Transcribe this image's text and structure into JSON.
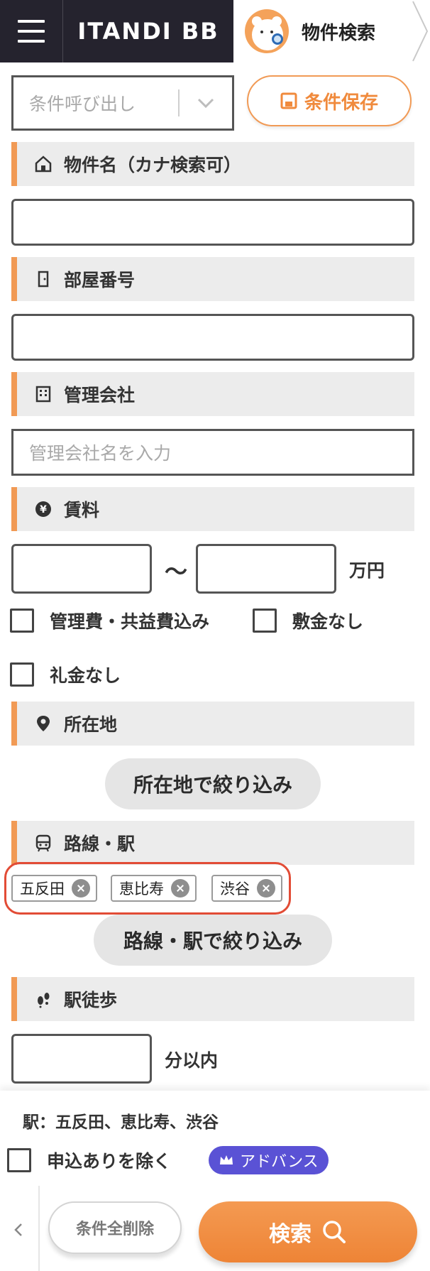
{
  "header": {
    "menu_icon": "hamburger-icon",
    "logo": "ITANDI BB",
    "breadcrumb": "物件検索",
    "mascot_icon": "bear-search-icon"
  },
  "conditions": {
    "select_placeholder": "条件呼び出し",
    "save_label": "条件保存"
  },
  "sections": {
    "property_name": {
      "label": "物件名（カナ検索可）",
      "icon": "home-icon"
    },
    "room_number": {
      "label": "部屋番号",
      "icon": "door-icon"
    },
    "management": {
      "label": "管理会社",
      "icon": "building-icon",
      "placeholder": "管理会社名を入力"
    },
    "rent": {
      "label": "賃料",
      "icon": "yen-icon",
      "tilde": "〜",
      "unit": "万円"
    },
    "location": {
      "label": "所在地",
      "icon": "pin-icon",
      "button": "所在地で絞り込み"
    },
    "line_station": {
      "label": "路線・駅",
      "icon": "train-icon",
      "button": "路線・駅で絞り込み"
    },
    "walk": {
      "label": "駅徒歩",
      "icon": "footprint-icon",
      "unit": "分以内"
    }
  },
  "checkboxes": {
    "management_fee": "管理費・共益費込み",
    "no_deposit": "敷金なし",
    "no_key_money": "礼金なし",
    "exclude_applied": "申込ありを除く"
  },
  "stations": [
    "五反田",
    "恵比寿",
    "渋谷"
  ],
  "summary": "駅：五反田、恵比寿、渋谷",
  "advance_badge": "アドバンス",
  "footer": {
    "clear_label": "条件全削除",
    "search_label": "検索"
  },
  "colors": {
    "accent": "#f19a55",
    "header_bg": "#25232e",
    "highlight_red": "#e24c36",
    "advance_purple": "#5a52d5"
  }
}
